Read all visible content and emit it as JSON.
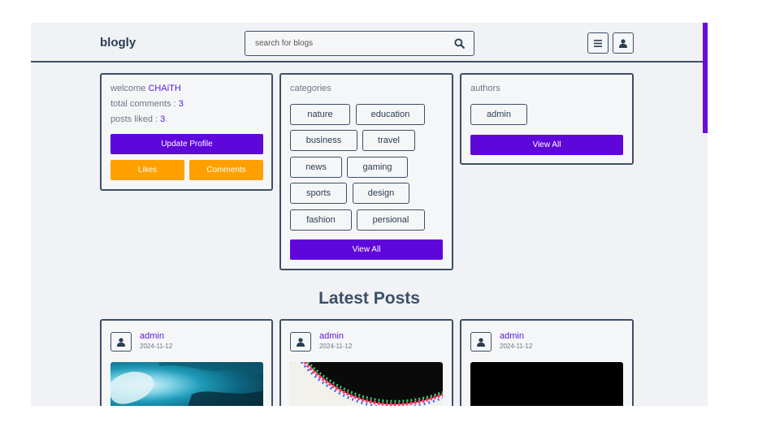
{
  "header": {
    "logo": "blogly",
    "search_placeholder": "search for blogs",
    "icons": [
      "search-icon",
      "menu-icon",
      "user-icon"
    ]
  },
  "profile": {
    "welcome_label": "welcome ",
    "username": "CHAiTH",
    "total_comments_label": "total comments : ",
    "total_comments": "3",
    "posts_liked_label": "posts liked : ",
    "posts_liked": "3",
    "update_label": "Update Profile",
    "likes_label": "Likes",
    "comments_label": "Comments"
  },
  "categories": {
    "heading": "categories",
    "items": [
      "nature",
      "education",
      "business",
      "travel",
      "news",
      "gaming",
      "sports",
      "design",
      "fashion",
      "persional"
    ],
    "view_all": "View All"
  },
  "authors": {
    "heading": "authors",
    "items": [
      "admin"
    ],
    "view_all": "View All"
  },
  "latest": {
    "title": "Latest Posts",
    "posts": [
      {
        "author": "admin",
        "date": "2024-11-12"
      },
      {
        "author": "admin",
        "date": "2024-11-12"
      },
      {
        "author": "admin",
        "date": "2024-11-12"
      }
    ]
  },
  "colors": {
    "primary": "#5f06db",
    "orange": "#ff9f00",
    "border": "#3d4f66",
    "accent_link": "#5a16d6"
  }
}
